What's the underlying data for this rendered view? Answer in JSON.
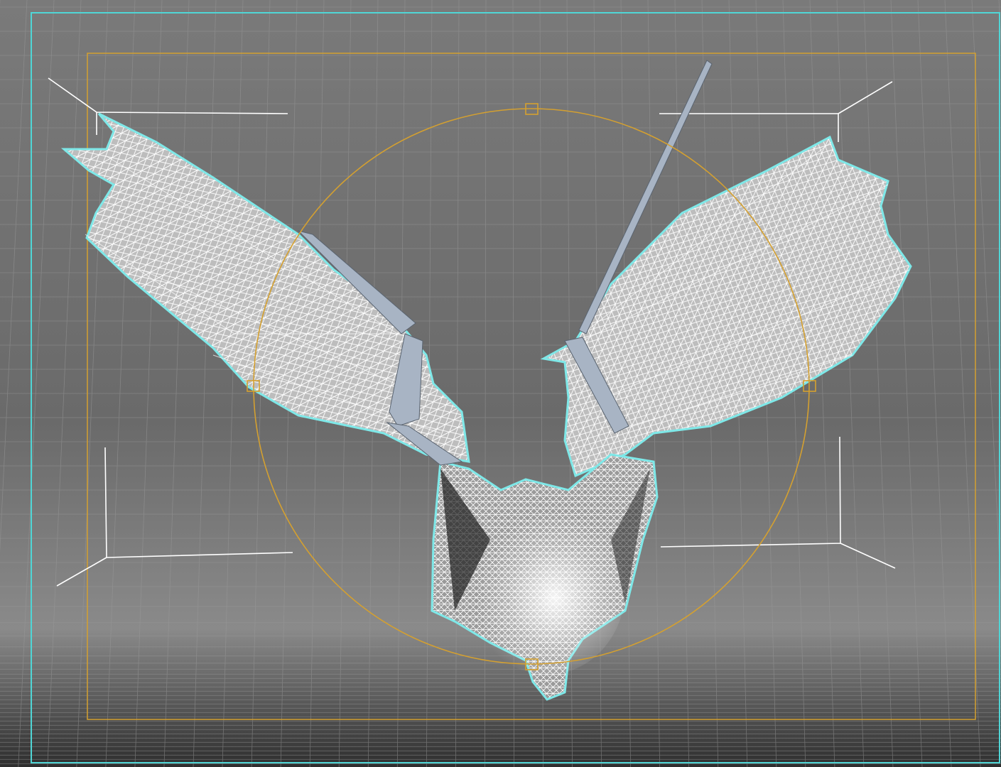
{
  "viewport": {
    "mode": "wireframe-perspective",
    "background_top": "#7a7a7a",
    "background_bottom": "#3a3a3a",
    "grid_color": "#9a9a9a",
    "grid_visible": true
  },
  "colors": {
    "viewport_border": "#4fd6d6",
    "safe_frame": "#d4a030",
    "transform_gizmo": "#d4a030",
    "selection_outline": "#7ee8e8",
    "wireframe": "#ffffff",
    "bone": "#a8b4c4",
    "bounding_corners": "#ffffff"
  },
  "selection": {
    "object": "bat-mesh",
    "selected": true
  },
  "gizmo": {
    "type": "rotate-circle",
    "handle_icons": [
      "handle-square-icon",
      "handle-square-icon",
      "handle-square-icon",
      "handle-square-icon"
    ]
  }
}
